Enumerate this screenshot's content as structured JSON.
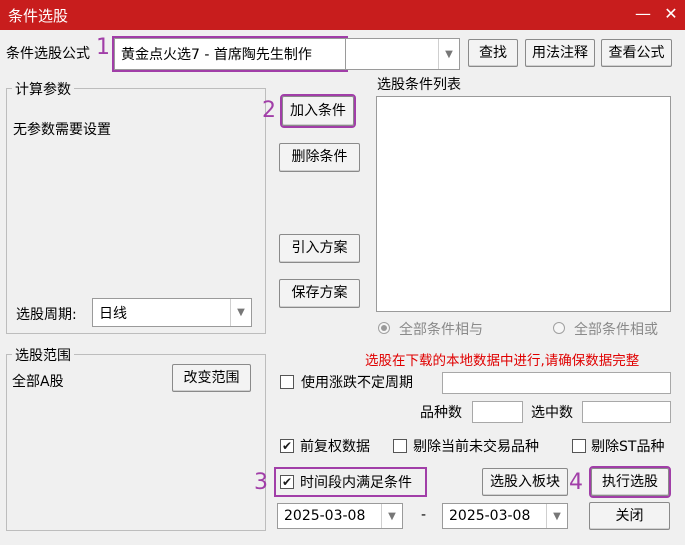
{
  "window": {
    "title": "条件选股",
    "minimize": "—",
    "close": "✕"
  },
  "formula": {
    "label": "条件选股公式",
    "marker": "1",
    "selected": "黄金点火选7  -  首席陶先生制作",
    "find_label": "查找",
    "usage_label": "用法注释",
    "view_label": "查看公式"
  },
  "params": {
    "legend": "计算参数",
    "none_text": "无参数需要设置",
    "period_label": "选股周期:",
    "period_value": "日线"
  },
  "conditions": {
    "marker": "2",
    "add_label": "加入条件",
    "delete_label": "删除条件",
    "import_label": "引入方案",
    "save_label": "保存方案",
    "list_label": "选股条件列表",
    "logic_and": "全部条件相与",
    "logic_or": "全部条件相或"
  },
  "range": {
    "legend": "选股范围",
    "value": "全部A股",
    "change_label": "改变范围"
  },
  "notice": "选股在下载的本地数据中进行,请确保数据完整",
  "options": {
    "variable_period": "使用涨跌不定周期",
    "variety_count_label": "品种数",
    "selected_count_label": "选中数",
    "adjusted": "前复权数据",
    "exclude_untraded": "剔除当前未交易品种",
    "exclude_st": "剔除ST品种",
    "time_range_marker": "3",
    "time_range": "时间段内满足条件"
  },
  "dates": {
    "start": "2025-03-08",
    "separator": "-",
    "end": "2025-03-08"
  },
  "actions": {
    "to_block_label": "选股入板块",
    "execute_marker": "4",
    "execute_label": "执行选股",
    "close_label": "关闭"
  },
  "colors": {
    "titlebar": "#c81d1d",
    "highlight": "#a13ea8",
    "notice": "#e00000"
  }
}
